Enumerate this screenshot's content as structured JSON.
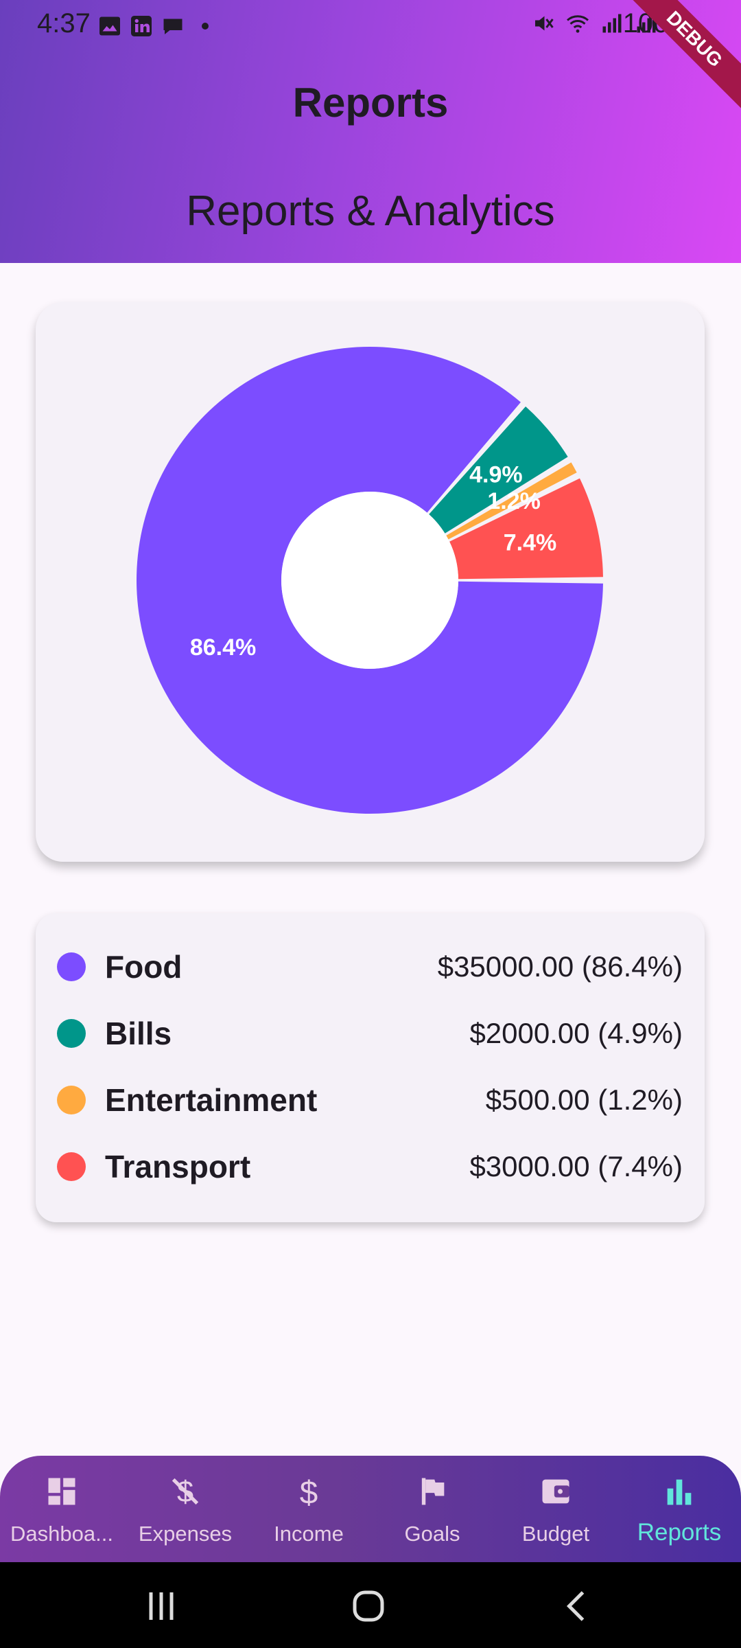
{
  "status_bar": {
    "time": "4:37",
    "battery": "100%",
    "debug_label": "DEBUG"
  },
  "header": {
    "title": "Reports",
    "subtitle": "Reports & Analytics"
  },
  "chart_data": {
    "type": "pie",
    "categories": [
      "Food",
      "Bills",
      "Entertainment",
      "Transport"
    ],
    "values": [
      35000,
      2000,
      500,
      3000
    ],
    "percent_labels": [
      "86.4%",
      "4.9%",
      "1.2%",
      "7.4%"
    ],
    "colors": [
      "#7c4dff",
      "#00968a",
      "#ffaa40",
      "#ff5252"
    ]
  },
  "legend": {
    "items": [
      {
        "label": "Food",
        "value": "$35000.00 (86.4%)",
        "color": "#7c4dff"
      },
      {
        "label": "Bills",
        "value": "$2000.00 (4.9%)",
        "color": "#00968a"
      },
      {
        "label": "Entertainment",
        "value": "$500.00 (1.2%)",
        "color": "#ffaa40"
      },
      {
        "label": "Transport",
        "value": "$3000.00 (7.4%)",
        "color": "#ff5252"
      }
    ]
  },
  "bottom_nav": {
    "items": [
      {
        "label": "Dashboa...",
        "icon": "dashboard-icon"
      },
      {
        "label": "Expenses",
        "icon": "money-off-icon"
      },
      {
        "label": "Income",
        "icon": "dollar-icon"
      },
      {
        "label": "Goals",
        "icon": "flag-icon"
      },
      {
        "label": "Budget",
        "icon": "wallet-icon"
      },
      {
        "label": "Reports",
        "icon": "bar-chart-icon",
        "active": true
      }
    ]
  },
  "system_nav": {
    "buttons": [
      "recents-icon",
      "home-icon",
      "back-icon"
    ]
  }
}
